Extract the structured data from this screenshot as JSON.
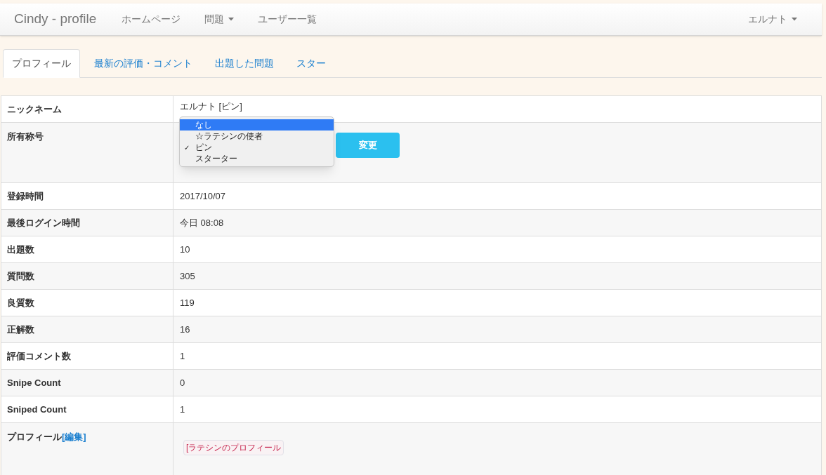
{
  "navbar": {
    "brand": "Cindy - profile",
    "items": [
      {
        "label": "ホームページ",
        "dropdown": false
      },
      {
        "label": "問題",
        "dropdown": true
      },
      {
        "label": "ユーザー一覧",
        "dropdown": false
      }
    ],
    "user": {
      "label": "エルナト",
      "dropdown": true
    }
  },
  "tabs": [
    {
      "label": "プロフィール",
      "selected": true
    },
    {
      "label": "最新の評価・コメント",
      "selected": false
    },
    {
      "label": "出題した問題",
      "selected": false
    },
    {
      "label": "スター",
      "selected": false
    }
  ],
  "rows": [
    {
      "kind": "text",
      "label": "ニックネーム",
      "value": "エルナト [ピン]"
    },
    {
      "kind": "title",
      "label": "所有称号",
      "options": [
        {
          "label": "なし",
          "highlighted": true,
          "checked": false
        },
        {
          "label": "☆ラテシンの使者",
          "highlighted": false,
          "checked": false
        },
        {
          "label": "ピン",
          "highlighted": false,
          "checked": true
        },
        {
          "label": "スターター",
          "highlighted": false,
          "checked": false
        }
      ],
      "check_mark": "✓",
      "button": "変更"
    },
    {
      "kind": "text",
      "label": "登録時間",
      "value": "2017/10/07"
    },
    {
      "kind": "text",
      "label": "最後ログイン時間",
      "value": "今日 08:08"
    },
    {
      "kind": "text",
      "label": "出題数",
      "value": "10"
    },
    {
      "kind": "text",
      "label": "質問数",
      "value": "305"
    },
    {
      "kind": "text",
      "label": "良質数",
      "value": "119"
    },
    {
      "kind": "text",
      "label": "正解数",
      "value": "16"
    },
    {
      "kind": "text",
      "label": "評価コメント数",
      "value": "1"
    },
    {
      "kind": "text",
      "label": "Snipe Count",
      "value": "0"
    },
    {
      "kind": "text",
      "label": "Sniped Count",
      "value": "1"
    },
    {
      "kind": "profile",
      "label": "プロフィール",
      "edit_link": "[編集]",
      "value": "[ラテシンのプロフィール"
    }
  ]
}
